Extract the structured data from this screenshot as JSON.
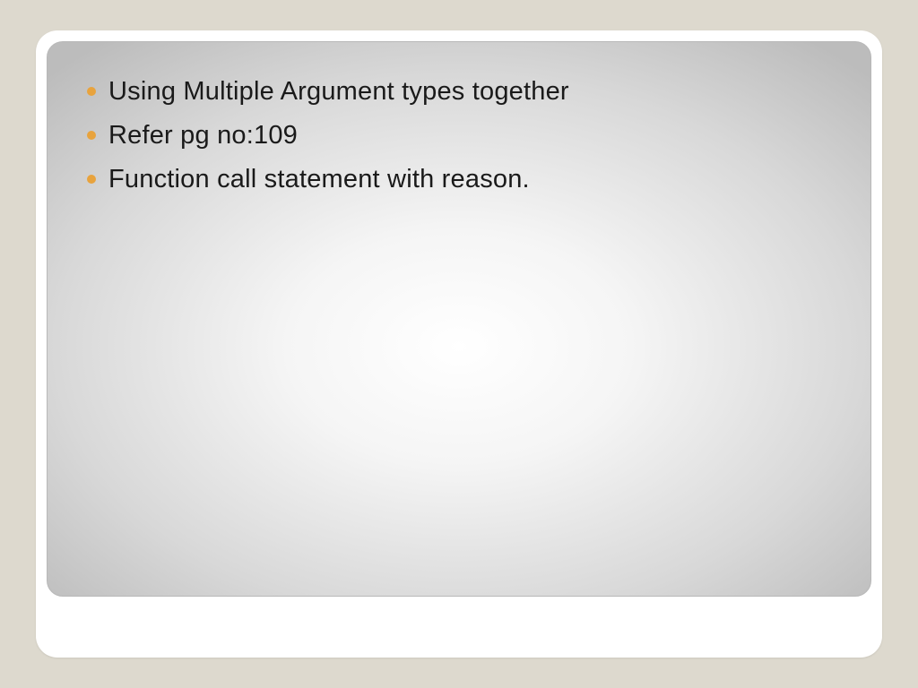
{
  "slide": {
    "bullets": [
      "Using Multiple Argument types together",
      "Refer pg no:109",
      "Function call statement with reason."
    ]
  },
  "colors": {
    "background": "#ddd9ce",
    "bullet": "#e8a33d",
    "text": "#1a1a1a"
  }
}
